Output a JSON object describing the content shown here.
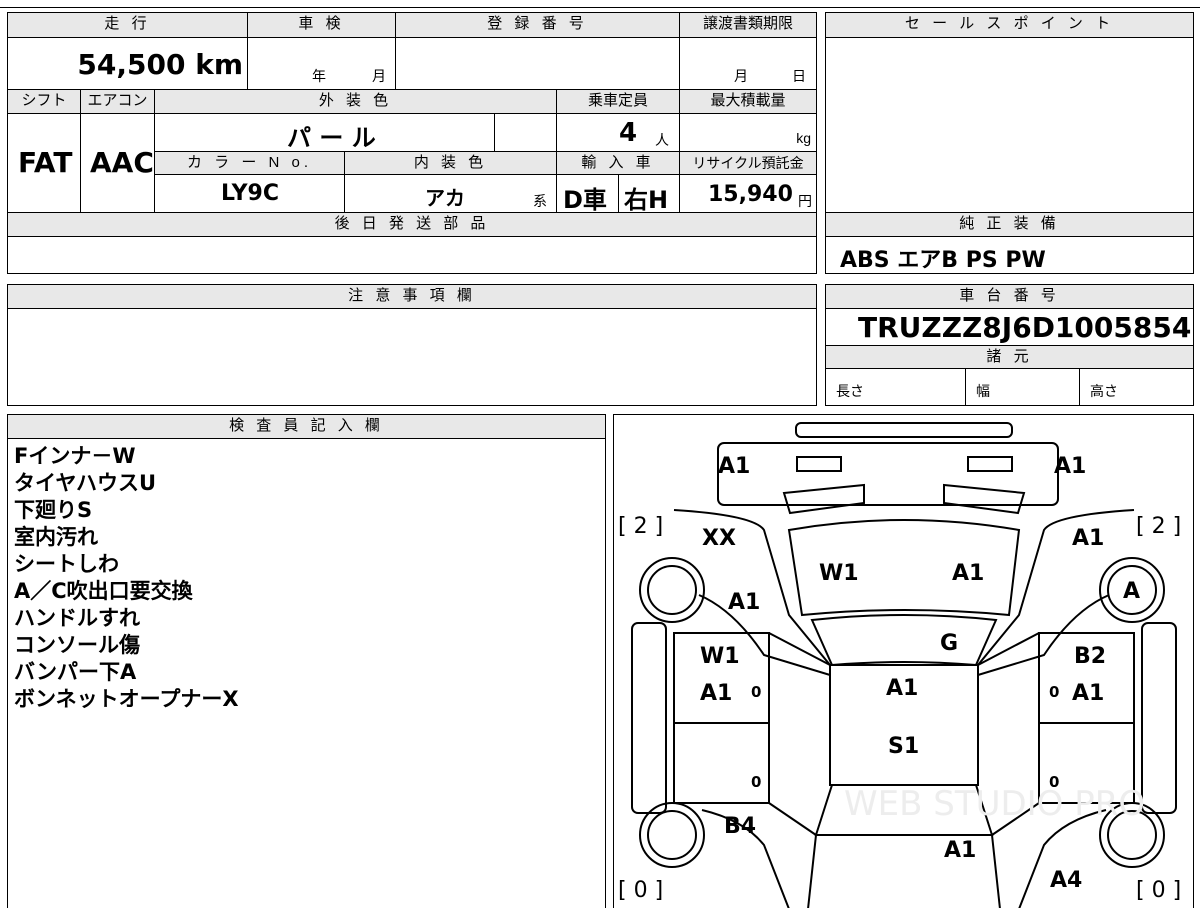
{
  "sheet": {
    "mileage_label": "走 行",
    "mileage_value": "54,500 km",
    "inspection_label": "車 検",
    "inspection_year": "年",
    "inspection_month": "月",
    "reg_label": "登 録 番 号",
    "transfer_label": "譲渡書類期限",
    "transfer_month": "月",
    "transfer_day": "日",
    "sales_label": "セ ー ル ス ポ イ ン ト",
    "shift_label": "シフト",
    "shift_value": "FAT",
    "ac_label": "エアコン",
    "ac_value": "AAC",
    "ext_color_label": "外 装 色",
    "ext_color_value": "パ ー ル",
    "capacity_label": "乗車定員",
    "capacity_value": "4",
    "capacity_unit": "人",
    "maxload_label": "最大積載量",
    "maxload_unit": "kg",
    "colorno_label": "カ ラ ー N o.",
    "colorno_value": "LY9C",
    "int_color_label": "内 装 色",
    "int_color_value": "アカ",
    "int_color_suffix": "系",
    "import_label": "輸 入 車",
    "import_value1": "D車",
    "import_value2": "右H",
    "recycle_label": "リサイクル預託金",
    "recycle_value": "15,940",
    "recycle_unit": "円",
    "later_parts_label": "後 日 発 送 部 品",
    "equip_label": "純 正 装 備",
    "equip_value": "ABS エアB PS PW",
    "notes_label": "注 意 事 項 欄",
    "chassis_label": "車 台 番 号",
    "chassis_value": "TRUZZZ8J6D1005854",
    "spec_label": "諸 元",
    "length_label": "長さ",
    "width_label": "幅",
    "height_label": "高さ",
    "inspector_label": "検 査 員 記 入 欄",
    "inspector_notes": [
      "Fインナ－W",
      "タイヤハウスU",
      "下廻りS",
      "室内汚れ",
      "シートしわ",
      "A／C吹出口要交換",
      "ハンドルすれ",
      "コンソール傷",
      "バンパー下A",
      "ボンネットオープナーX"
    ]
  },
  "diagram": {
    "front_left": "A1",
    "front_right": "A1",
    "tire_fl": "[ 2 ]",
    "tire_fr": "[ 2 ]",
    "tire_rl": "[ 0 ]",
    "tire_rr": "[ 0 ]",
    "fender_l_top": "XX",
    "fender_l": "A1",
    "hood_l": "W1",
    "hood_r": "A1",
    "fender_r_top": "A1",
    "wheel_r": "A",
    "windshield": "G",
    "door_fl_1": "W1",
    "door_fl_2": "A1",
    "door_fr_1": "B2",
    "door_fr_2": "A1",
    "roof": "A1",
    "roof2": "S1",
    "small_fl": "0",
    "small_fr": "0",
    "small_rl": "0",
    "small_rr": "0",
    "rear_l": "B4",
    "trunk": "A1",
    "rear_r": "A4",
    "watermark": "WEB STUDIO PRO"
  }
}
